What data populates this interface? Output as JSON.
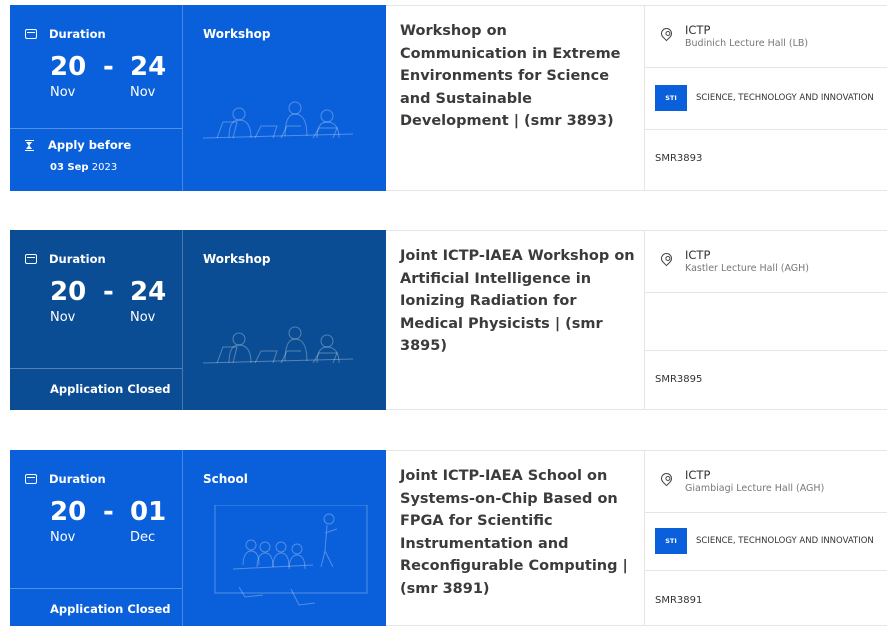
{
  "events": [
    {
      "duration_label": "Duration",
      "start_day": "20",
      "dash": "-",
      "end_day": "24",
      "start_month": "Nov",
      "end_month": "Nov",
      "apply_label": "Apply before",
      "apply_date_bold": "03 Sep",
      "apply_year": "2023",
      "type": "Workshop",
      "title": "Workshop on Communication in Extreme Environments for Science and Sustainable Development | (smr 3893)",
      "venue": "ICTP",
      "room": "Budinich Lecture Hall (LB)",
      "topic_badge": "STI",
      "topic": "SCIENCE, TECHNOLOGY AND INNOVATION",
      "code": "SMR3893"
    },
    {
      "duration_label": "Duration",
      "start_day": "20",
      "dash": "-",
      "end_day": "24",
      "start_month": "Nov",
      "end_month": "Nov",
      "status": "Application Closed",
      "type": "Workshop",
      "title": "Joint ICTP-IAEA Workshop on Artificial Intelligence in Ionizing Radiation for Medical Physicists | (smr 3895)",
      "venue": "ICTP",
      "room": "Kastler Lecture Hall (AGH)",
      "code": "SMR3895"
    },
    {
      "duration_label": "Duration",
      "start_day": "20",
      "dash": "-",
      "end_day": "01",
      "start_month": "Nov",
      "end_month": "Dec",
      "status": "Application Closed",
      "type": "School",
      "title": "Joint ICTP-IAEA School on Systems-on-Chip Based on FPGA for Scientific Instrumentation and Reconfigurable Computing | (smr 3891)",
      "venue": "ICTP",
      "room": "Giambiagi Lecture Hall (AGH)",
      "topic_badge": "STI",
      "topic": "SCIENCE, TECHNOLOGY AND INNOVATION",
      "code": "SMR3891"
    }
  ],
  "colors": {
    "open_bg": "#0a5fdb",
    "closed_bg": "#0b4d94",
    "badge_bg": "#0a5fdb"
  },
  "icons": [
    "calendar-icon",
    "hourglass-icon",
    "map-pin-icon"
  ]
}
